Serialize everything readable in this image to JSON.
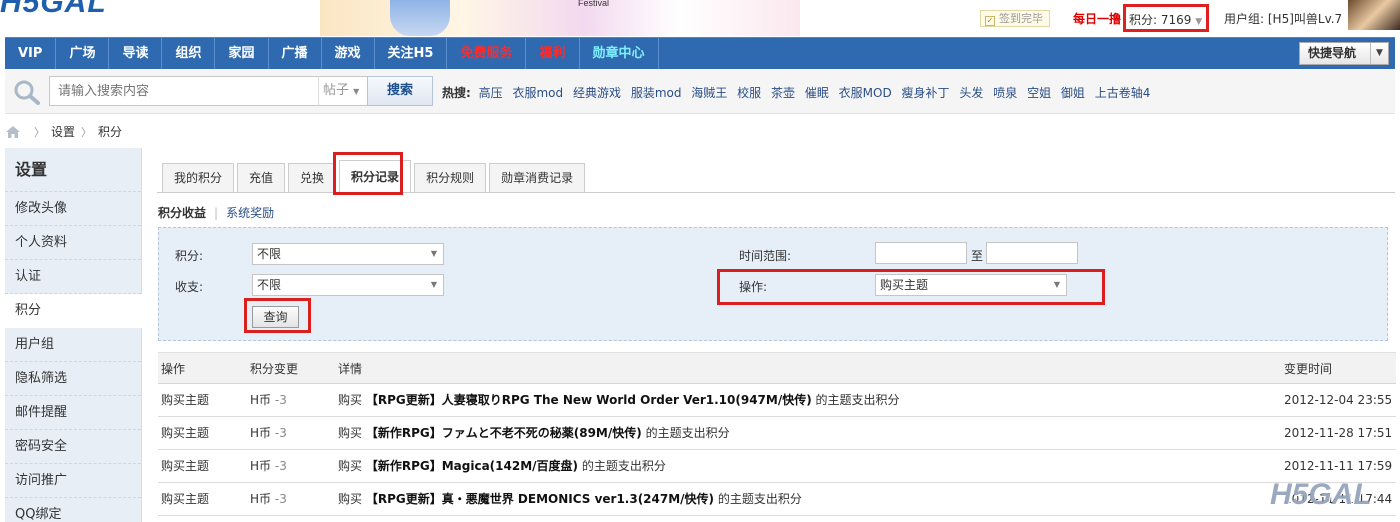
{
  "header": {
    "logo_text": "H5GAL",
    "festival_text": "Festival",
    "signin_label": "签到完毕",
    "daily_label": "每日一撸",
    "score_label": "积分: 7169",
    "usergroup_label": "用户组: [H5]叫兽Lv.7"
  },
  "nav": {
    "items": [
      "VIP",
      "广场",
      "导读",
      "组织",
      "家园",
      "广播",
      "游戏",
      "关注H5",
      "免费服务",
      "福利",
      "勋章中心"
    ],
    "quicknav_label": "快捷导航"
  },
  "search": {
    "placeholder": "请输入搜索内容",
    "type_label": "帖子",
    "button_label": "搜索",
    "hot_label": "热搜:",
    "hot_terms": [
      "高压",
      "衣服mod",
      "经典游戏",
      "服装mod",
      "海贼王",
      "校服",
      "茶壶",
      "催眠",
      "衣服MOD",
      "瘦身补丁",
      "头发",
      "喷泉",
      "空姐",
      "御姐",
      "上古卷轴4"
    ]
  },
  "breadcrumb": [
    "设置",
    "积分"
  ],
  "sidebar": {
    "title": "设置",
    "items": [
      "修改头像",
      "个人资料",
      "认证",
      "积分",
      "用户组",
      "隐私筛选",
      "邮件提醒",
      "密码安全",
      "访问推广",
      "QQ绑定"
    ],
    "active_index": 3
  },
  "tabs": [
    "我的积分",
    "充值",
    "兑换",
    "积分记录",
    "积分规则",
    "勋章消费记录"
  ],
  "active_tab": "积分记录",
  "subtabs": {
    "current": "积分收益",
    "other": "系统奖励"
  },
  "filter": {
    "credit_label": "积分:",
    "credit_value": "不限",
    "inout_label": "收支:",
    "inout_value": "不限",
    "time_label": "时间范围:",
    "time_to": "至",
    "op_label": "操作:",
    "op_value": "购买主题",
    "query_button": "查询"
  },
  "table": {
    "headers": [
      "操作",
      "积分变更",
      "详情",
      "变更时间"
    ],
    "rows": [
      {
        "op": "购买主题",
        "currency": "H币",
        "change": "-3",
        "prefix": "购买",
        "title": "【RPG更新】人妻寝取りRPG The New World Order Ver1.10(947M/快传)",
        "suffix": "的主题支出积分",
        "time": "2012-12-04 23:55"
      },
      {
        "op": "购买主题",
        "currency": "H币",
        "change": "-3",
        "prefix": "购买",
        "title": "【新作RPG】ファムと不老不死の秘薬(89M/快传)",
        "suffix": "的主题支出积分",
        "time": "2012-11-28 17:51"
      },
      {
        "op": "购买主题",
        "currency": "H币",
        "change": "-3",
        "prefix": "购买",
        "title": "【新作RPG】Magica(142M/百度盘)",
        "suffix": "的主题支出积分",
        "time": "2012-11-11 17:59"
      },
      {
        "op": "购买主题",
        "currency": "H币",
        "change": "-3",
        "prefix": "购买",
        "title": "【RPG更新】真・悪魔世界 DEMONICS ver1.3(247M/快传)",
        "suffix": "的主题支出积分",
        "time": "2012-11-11 17:44"
      }
    ]
  },
  "watermark_text": "H5GAL"
}
